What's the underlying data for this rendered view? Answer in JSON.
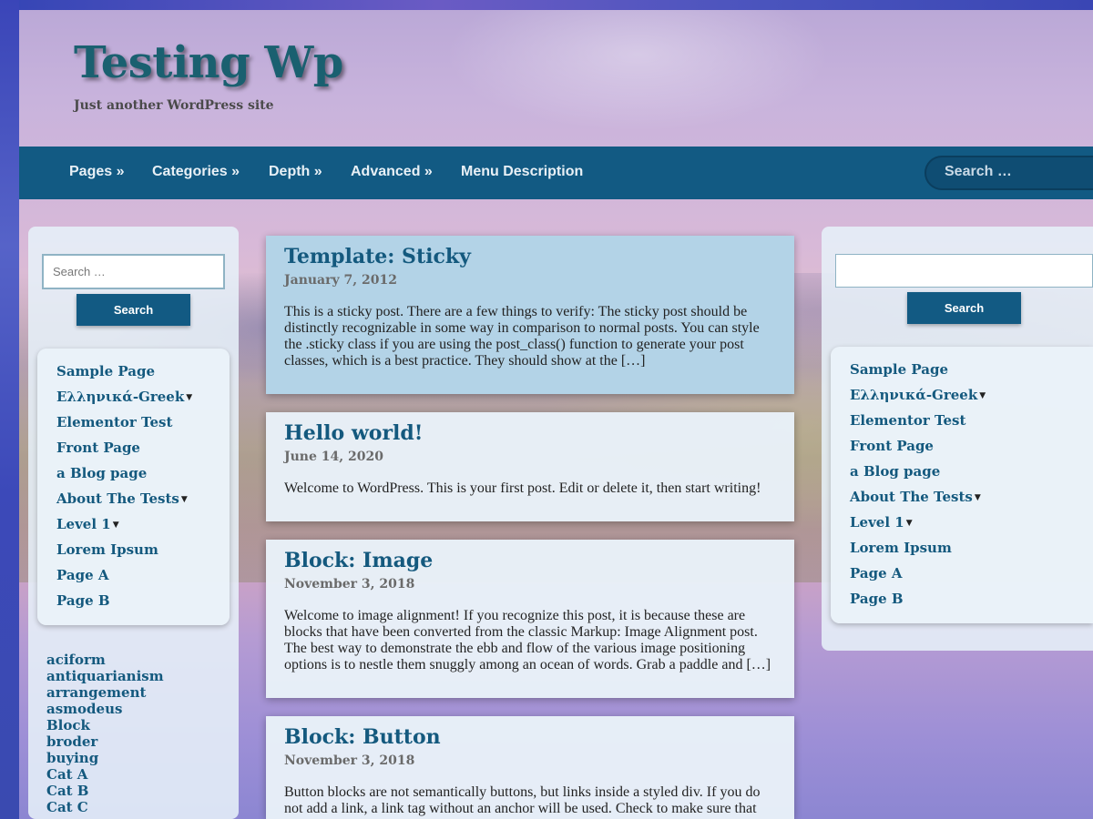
{
  "site": {
    "title": "Testing Wp",
    "description": "Just another WordPress site"
  },
  "nav": {
    "items": [
      {
        "label": "Pages »"
      },
      {
        "label": "Categories »"
      },
      {
        "label": "Depth »"
      },
      {
        "label": "Advanced »"
      },
      {
        "label": "Menu Description"
      }
    ],
    "search_placeholder": "Search …"
  },
  "left_sidebar": {
    "search_placeholder": "Search …",
    "search_button": "Search",
    "pages": [
      {
        "label": "Sample Page",
        "has_children": false
      },
      {
        "label": "Ελληνικά-Greek",
        "has_children": true
      },
      {
        "label": "Elementor Test",
        "has_children": false
      },
      {
        "label": "Front Page",
        "has_children": false
      },
      {
        "label": "a Blog page",
        "has_children": false
      },
      {
        "label": "About The Tests",
        "has_children": true
      },
      {
        "label": "Level 1",
        "has_children": true
      },
      {
        "label": "Lorem Ipsum",
        "has_children": false
      },
      {
        "label": "Page A",
        "has_children": false
      },
      {
        "label": "Page B",
        "has_children": false
      }
    ],
    "tags": [
      "aciform",
      "antiquarianism",
      "arrangement",
      "asmodeus",
      "Block",
      "broder",
      "buying",
      "Cat A",
      "Cat B",
      "Cat C"
    ]
  },
  "right_sidebar": {
    "search_placeholder": "",
    "search_button": "Search",
    "pages": [
      {
        "label": "Sample Page"
      },
      {
        "label": "Ελληνικά-Greek"
      },
      {
        "label": "Elementor Test"
      },
      {
        "label": "Front Page"
      },
      {
        "label": "a Blog page"
      },
      {
        "label": "About The Tests"
      },
      {
        "label": "Level 1"
      },
      {
        "label": "Lorem Ipsum"
      },
      {
        "label": "Page A"
      },
      {
        "label": "Page B"
      }
    ]
  },
  "posts": [
    {
      "title": "Template: Sticky",
      "date": "January 7, 2012",
      "excerpt": "This is a sticky post. There are a few things to verify: The sticky post should be distinctly recognizable in some way in comparison to normal posts. You can style the .sticky class if you are using the post_class() function to generate your post classes, which is a best practice. They should show at the […]"
    },
    {
      "title": "Hello world!",
      "date": "June 14, 2020",
      "excerpt": "Welcome to WordPress. This is your first post. Edit or delete it, then start writing!"
    },
    {
      "title": "Block: Image",
      "date": "November 3, 2018",
      "excerpt": "Welcome to image alignment! If you recognize this post, it is because these are blocks that have been converted from the classic Markup: Image Alignment post. The best way to demonstrate the ebb and flow of the various image positioning options is to nestle them snuggly among an ocean of words. Grab a paddle and […]"
    },
    {
      "title": "Block: Button",
      "date": "November 3, 2018",
      "excerpt": "Button blocks are not semantically buttons, but links inside a styled div.  If you do not add a link, a link tag without an anchor will be used. Check to make sure that"
    }
  ]
}
